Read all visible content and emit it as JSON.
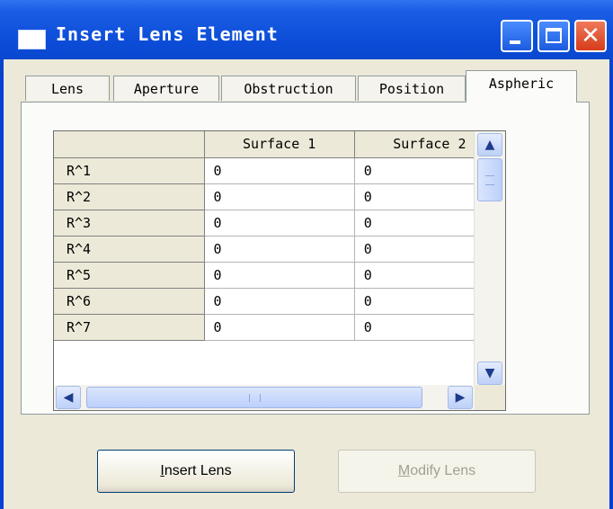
{
  "window": {
    "title": "Insert Lens Element",
    "close_glyph": "✕"
  },
  "tabs": [
    {
      "label": "Lens",
      "selected": false
    },
    {
      "label": "Aperture",
      "selected": false
    },
    {
      "label": "Obstruction",
      "selected": false
    },
    {
      "label": "Position",
      "selected": false
    },
    {
      "label": "Aspheric",
      "selected": true
    }
  ],
  "grid": {
    "columns": [
      "",
      "Surface 1",
      "Surface 2"
    ],
    "rows": [
      {
        "label": "R^1",
        "values": [
          "0",
          "0"
        ]
      },
      {
        "label": "R^2",
        "values": [
          "0",
          "0"
        ]
      },
      {
        "label": "R^3",
        "values": [
          "0",
          "0"
        ]
      },
      {
        "label": "R^4",
        "values": [
          "0",
          "0"
        ]
      },
      {
        "label": "R^5",
        "values": [
          "0",
          "0"
        ]
      },
      {
        "label": "R^6",
        "values": [
          "0",
          "0"
        ]
      },
      {
        "label": "R^7",
        "values": [
          "0",
          "0"
        ]
      }
    ],
    "scroll_up": "▲",
    "scroll_down": "▼",
    "scroll_left": "◀",
    "scroll_right": "▶"
  },
  "buttons": {
    "insert": {
      "mnemonic": "I",
      "rest": "nsert Lens",
      "enabled": true
    },
    "modify": {
      "mnemonic": "M",
      "rest": "odify Lens",
      "enabled": false
    }
  },
  "colors": {
    "titlebar": "#0b4bd6",
    "dialog_face": "#ece9d8",
    "close_button": "#d63c1a"
  }
}
